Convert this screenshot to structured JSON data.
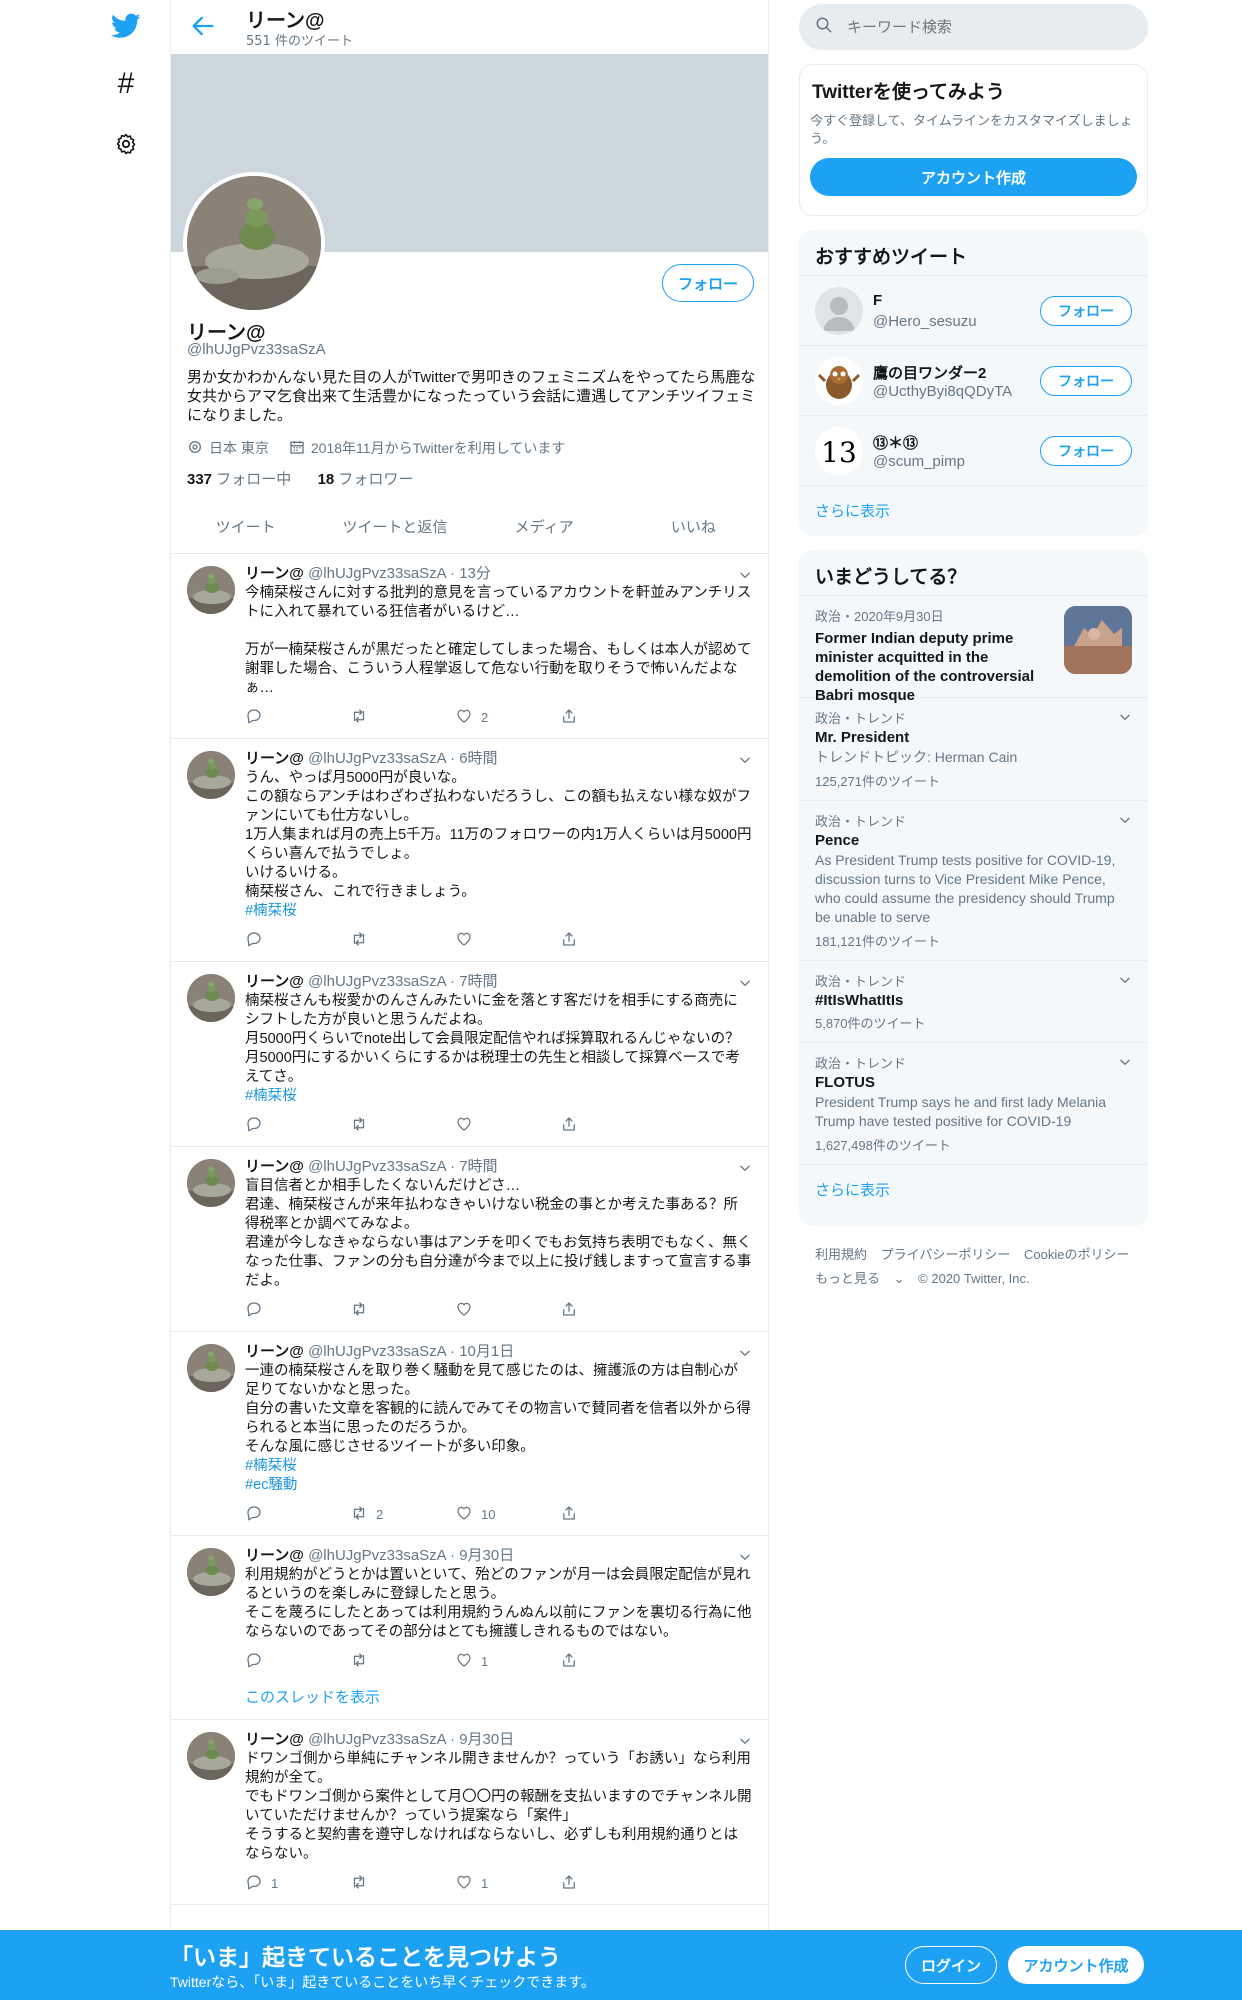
{
  "header": {
    "title": "リーン@",
    "tweet_count": "551 件のツイート"
  },
  "profile": {
    "follow_label": "フォロー",
    "name": "リーン@",
    "handle": "@lhUJgPvz33saSzA",
    "bio": "男か女かわかんない見た目の人がTwitterで男叩きのフェミニズムをやってたら馬鹿な女共からアマ乞食出来て生活豊かになったっていう会話に遭遇してアンチツイフェミになりました。",
    "location": "日本 東京",
    "joined": "2018年11月からTwitterを利用しています",
    "following_count": "337",
    "following_label": "フォロー中",
    "followers_count": "18",
    "followers_label": "フォロワー"
  },
  "tabs": [
    "ツイート",
    "ツイートと返信",
    "メディア",
    "いいね"
  ],
  "tweets": [
    {
      "name": "リーン@",
      "handle": "@lhUJgPvz33saSzA",
      "time": "13分",
      "text": "今楠栞桜さんに対する批判的意見を言っているアカウントを軒並みアンチリストに入れて暴れている狂信者がいるけど…\n\n万が一楠栞桜さんが黒だったと確定してしまった場合、もしくは本人が認めて謝罪した場合、こういう人程掌返して危ない行動を取りそうで怖いんだよなぁ…",
      "tags": [],
      "replies": "",
      "retweets": "",
      "likes": "2"
    },
    {
      "name": "リーン@",
      "handle": "@lhUJgPvz33saSzA",
      "time": "6時間",
      "text": "うん、やっぱ月5000円が良いな。\nこの額ならアンチはわざわざ払わないだろうし、この額も払えない様な奴がファンにいても仕方ないし。\n1万人集まれば月の売上5千万。11万のフォロワーの内1万人くらいは月5000円くらい喜んで払うでしょ。\nいけるいける。\n楠栞桜さん、これで行きましょう。",
      "tags": [
        "#楠栞桜"
      ],
      "replies": "",
      "retweets": "",
      "likes": ""
    },
    {
      "name": "リーン@",
      "handle": "@lhUJgPvz33saSzA",
      "time": "7時間",
      "text": "楠栞桜さんも桜愛かのんさんみたいに金を落とす客だけを相手にする商売にシフトした方が良いと思うんだよね。\n月5000円くらいでnote出して会員限定配信やれば採算取れるんじゃないの？\n月5000円にするかいくらにするかは税理士の先生と相談して採算ベースで考えてさ。",
      "tags": [
        "#楠栞桜"
      ],
      "replies": "",
      "retweets": "",
      "likes": ""
    },
    {
      "name": "リーン@",
      "handle": "@lhUJgPvz33saSzA",
      "time": "7時間",
      "text": "盲目信者とか相手したくないんだけどさ…\n君達、楠栞桜さんが来年払わなきゃいけない税金の事とか考えた事ある？所得税率とか調べてみなよ。\n君達が今しなきゃならない事はアンチを叩くでもお気持ち表明でもなく、無くなった仕事、ファンの分も自分達が今まで以上に投げ銭しますって宣言する事だよ。",
      "tags": [],
      "replies": "",
      "retweets": "",
      "likes": ""
    },
    {
      "name": "リーン@",
      "handle": "@lhUJgPvz33saSzA",
      "time": "10月1日",
      "text": "一連の楠栞桜さんを取り巻く騒動を見て感じたのは、擁護派の方は自制心が足りてないかなと思った。\n自分の書いた文章を客観的に読んでみてその物言いで賛同者を信者以外から得られると本当に思ったのだろうか。\nそんな風に感じさせるツイートが多い印象。",
      "tags": [
        "#楠栞桜",
        "#ec騒動"
      ],
      "replies": "",
      "retweets": "2",
      "likes": "10"
    },
    {
      "name": "リーン@",
      "handle": "@lhUJgPvz33saSzA",
      "time": "9月30日",
      "text": "利用規約がどうとかは置いといて、殆どのファンが月一は会員限定配信が見れるというのを楽しみに登録したと思う。\nそこを蔑ろにしたとあっては利用規約うんぬん以前にファンを裏切る行為に他ならないのであってその部分はとても擁護しきれるものではない。",
      "tags": [],
      "replies": "",
      "retweets": "",
      "likes": "1",
      "thread_link": "このスレッドを表示"
    },
    {
      "name": "リーン@",
      "handle": "@lhUJgPvz33saSzA",
      "time": "9月30日",
      "text": "ドワンゴ側から単純にチャンネル開きませんか？っていう「お誘い」なら利用規約が全て。\nでもドワンゴ側から案件として月〇〇円の報酬を支払いますのでチャンネル開いていただけませんか？っていう提案なら「案件」\nそうすると契約書を遵守しなければならないし、必ずしも利用規約通りとはならない。",
      "tags": [],
      "replies": "1",
      "retweets": "",
      "likes": "1"
    }
  ],
  "search": {
    "placeholder": "キーワード検索"
  },
  "signup_card": {
    "title": "Twitterを使ってみよう",
    "text": "今すぐ登録して、タイムラインをカスタマイズしましょう。",
    "button": "アカウント作成"
  },
  "recommended": {
    "title": "おすすめツイート",
    "accounts": [
      {
        "name": "F",
        "handle": "@Hero_sesuzu",
        "button": "フォロー"
      },
      {
        "name": "鷹の目ワンダー2",
        "handle": "@UcthyByi8qQDyTA",
        "button": "フォロー"
      },
      {
        "name": "⑬＊⑬",
        "handle": "@scum_pimp",
        "button": "フォロー"
      }
    ],
    "more": "さらに表示"
  },
  "trends": {
    "title": "いまどうしてる？",
    "news": {
      "category": "政治・2020年9月30日",
      "text": "Former Indian deputy prime minister acquitted in the demolition of the controversial Babri mosque"
    },
    "items": [
      {
        "category": "政治・トレンド",
        "name": "Mr. President",
        "desc": "トレンドトピック: Herman Cain",
        "count": "125,271件のツイート"
      },
      {
        "category": "政治・トレンド",
        "name": "Pence",
        "desc": "As President Trump tests positive for COVID-19, discussion turns to Vice President Mike Pence, who could assume the presidency should Trump be unable to serve",
        "count": "181,121件のツイート"
      },
      {
        "category": "政治・トレンド",
        "name": "#ItIsWhatItIs",
        "desc": "",
        "count": "5,870件のツイート"
      },
      {
        "category": "政治・トレンド",
        "name": "FLOTUS",
        "desc": "President Trump says he and first lady Melania Trump have tested positive for COVID-19",
        "count": "1,627,498件のツイート"
      }
    ],
    "more": "さらに表示"
  },
  "footer": {
    "terms": "利用規約",
    "privacy": "プライバシーポリシー",
    "cookie": "Cookieのポリシー",
    "more": "もっと見る",
    "copyright": "© 2020 Twitter, Inc."
  },
  "bottom_bar": {
    "title": "「いま」起きていることを見つけよう",
    "subtitle": "Twitterなら、「いま」起きていることをいち早くチェックできます。",
    "login": "ログイン",
    "signup": "アカウント作成"
  },
  "colors": {
    "accent": "#1da1f2",
    "text": "#14171a",
    "muted": "#657786",
    "banner": "#ccd6dd"
  },
  "icons": [
    "twitter-bird-icon",
    "hashtag-icon",
    "gear-icon",
    "back-arrow-icon",
    "location-icon",
    "calendar-icon",
    "reply-icon",
    "retweet-icon",
    "like-icon",
    "share-icon",
    "chevron-down-icon",
    "search-icon"
  ]
}
